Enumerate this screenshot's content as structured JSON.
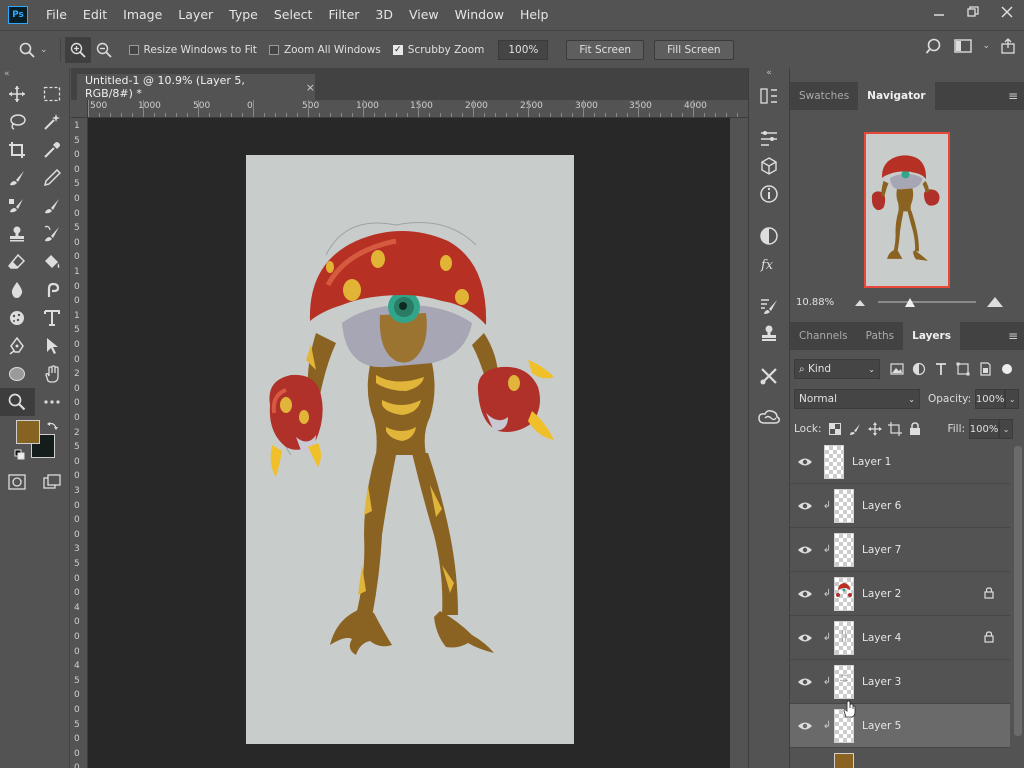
{
  "app": {
    "logo_text": "Ps"
  },
  "menu": [
    "File",
    "Edit",
    "Image",
    "Layer",
    "Type",
    "Select",
    "Filter",
    "3D",
    "View",
    "Window",
    "Help"
  ],
  "window_controls": [
    "minimize",
    "restore",
    "close"
  ],
  "options_bar": {
    "resize_windows_label": "Resize Windows to Fit",
    "resize_windows_checked": false,
    "zoom_all_label": "Zoom All Windows",
    "zoom_all_checked": false,
    "scrubby_zoom_label": "Scrubby Zoom",
    "scrubby_zoom_checked": true,
    "zoom_value": "100%",
    "fit_screen_label": "Fit Screen",
    "fill_screen_label": "Fill Screen"
  },
  "colors": {
    "foreground": "#876321",
    "background": "#141c1c",
    "ui_bg": "#535353",
    "navigator_frame": "#e8473a"
  },
  "document": {
    "tab_title": "Untitled-1 @ 10.9% (Layer 5, RGB/8#) *",
    "close_glyph": "×"
  },
  "ruler": {
    "top_labels": [
      "500",
      "1000",
      "500",
      "0",
      "500",
      "1000",
      "1500",
      "2000",
      "2500",
      "3000",
      "3500",
      "4000"
    ],
    "left_labels": [
      "1",
      "5",
      "0",
      "0",
      "5",
      "0",
      "0",
      "5",
      "0",
      "0",
      "1",
      "0",
      "0",
      "1",
      "5",
      "0",
      "0",
      "2",
      "0",
      "0",
      "0",
      "2",
      "5",
      "0",
      "0",
      "3",
      "0",
      "0",
      "0",
      "3",
      "5",
      "0",
      "0",
      "4",
      "0",
      "0",
      "0",
      "4",
      "5",
      "0",
      "0",
      "5",
      "0",
      "0",
      "0"
    ]
  },
  "navigator": {
    "tabs": [
      "Swatches",
      "Navigator"
    ],
    "active_tab": "Navigator",
    "zoom_value": "10.88%",
    "slider_fraction": 0.33
  },
  "layers_panel": {
    "tabs": [
      "Channels",
      "Paths",
      "Layers"
    ],
    "active_tab": "Layers",
    "kind_label": "Kind",
    "blend_mode": "Normal",
    "opacity_label": "Opacity:",
    "opacity_value": "100%",
    "lock_label": "Lock:",
    "fill_label": "Fill:",
    "fill_value": "100%",
    "layers": [
      {
        "name": "Layer 1",
        "clipped": false,
        "locked": false,
        "selected": false,
        "thumb": "empty"
      },
      {
        "name": "Layer 6",
        "clipped": true,
        "locked": false,
        "selected": false,
        "thumb": "empty"
      },
      {
        "name": "Layer 7",
        "clipped": true,
        "locked": false,
        "selected": false,
        "thumb": "empty"
      },
      {
        "name": "Layer 2",
        "clipped": true,
        "locked": true,
        "selected": false,
        "thumb": "creature-head"
      },
      {
        "name": "Layer 4",
        "clipped": true,
        "locked": true,
        "selected": false,
        "thumb": "creature-faint"
      },
      {
        "name": "Layer 3",
        "clipped": true,
        "locked": false,
        "selected": false,
        "thumb": "creature-faint"
      },
      {
        "name": "Layer 5",
        "clipped": true,
        "locked": false,
        "selected": true,
        "thumb": "empty"
      }
    ]
  }
}
